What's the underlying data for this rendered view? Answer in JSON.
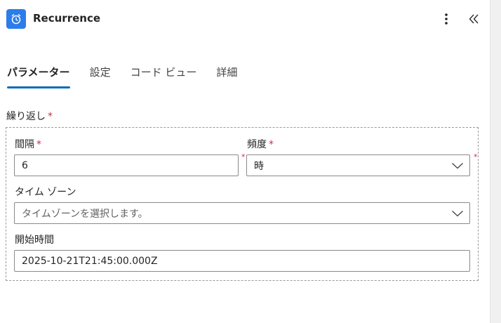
{
  "header": {
    "title": "Recurrence",
    "app_icon": "alarm-clock-icon",
    "accent": "#2b7de9"
  },
  "tabs": [
    {
      "label": "パラメーター",
      "active": true
    },
    {
      "label": "設定",
      "active": false
    },
    {
      "label": "コード ビュー",
      "active": false
    },
    {
      "label": "詳細",
      "active": false
    }
  ],
  "form": {
    "group_label": "繰り返し",
    "required_mark": "*",
    "interval": {
      "label": "間隔",
      "value": "6"
    },
    "frequency": {
      "label": "頻度",
      "value": "時"
    },
    "timezone": {
      "label": "タイム ゾーン",
      "placeholder": "タイムゾーンを選択します。"
    },
    "start_time": {
      "label": "開始時間",
      "value": "2025-10-21T21:45:00.000Z"
    }
  },
  "colors": {
    "tab_underline": "#0f6cbd",
    "required": "#c4314b"
  }
}
